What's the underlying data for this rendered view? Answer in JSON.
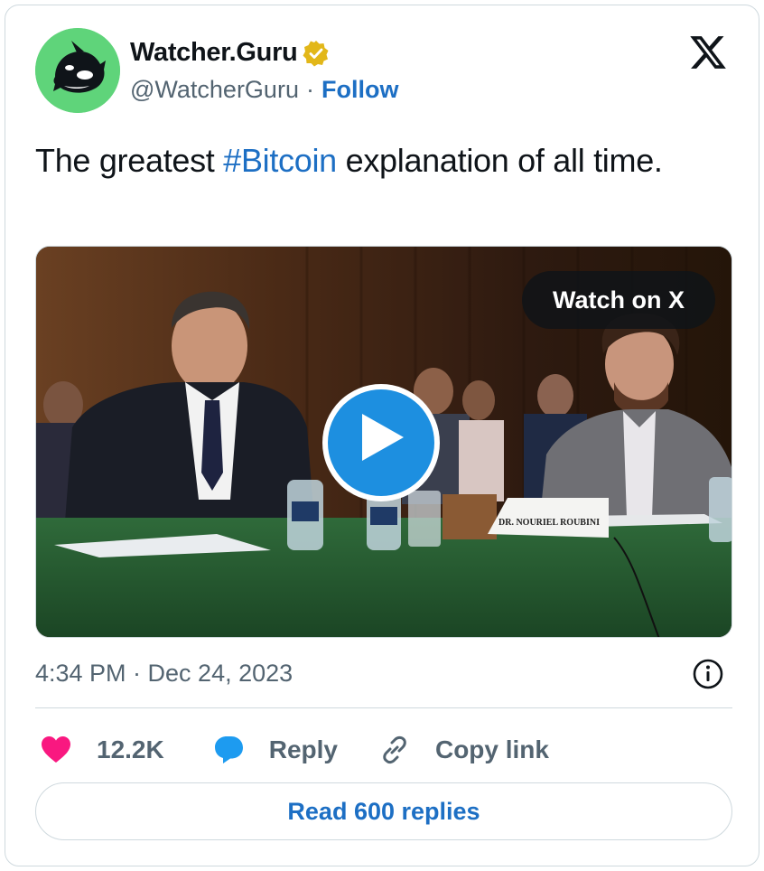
{
  "author": {
    "display_name": "Watcher.Guru",
    "handle": "@WatcherGuru",
    "separator": "·",
    "follow_label": "Follow"
  },
  "tweet": {
    "text_before": "The greatest ",
    "hashtag": "#Bitcoin",
    "text_after": " explanation of all time."
  },
  "media": {
    "watch_label": "Watch on X",
    "nameplate": "DR. NOURIEL ROUBINI"
  },
  "meta": {
    "timestamp": "4:34 PM · Dec 24, 2023"
  },
  "actions": {
    "like_count": "12.2K",
    "reply_label": "Reply",
    "copy_label": "Copy link"
  },
  "footer": {
    "read_replies_label": "Read 600 replies"
  },
  "colors": {
    "accent": "#1d6fc4",
    "like": "#f91880",
    "reply": "#1d9bf0",
    "avatar_bg": "#5fd47a",
    "verified": "#e2b719"
  }
}
